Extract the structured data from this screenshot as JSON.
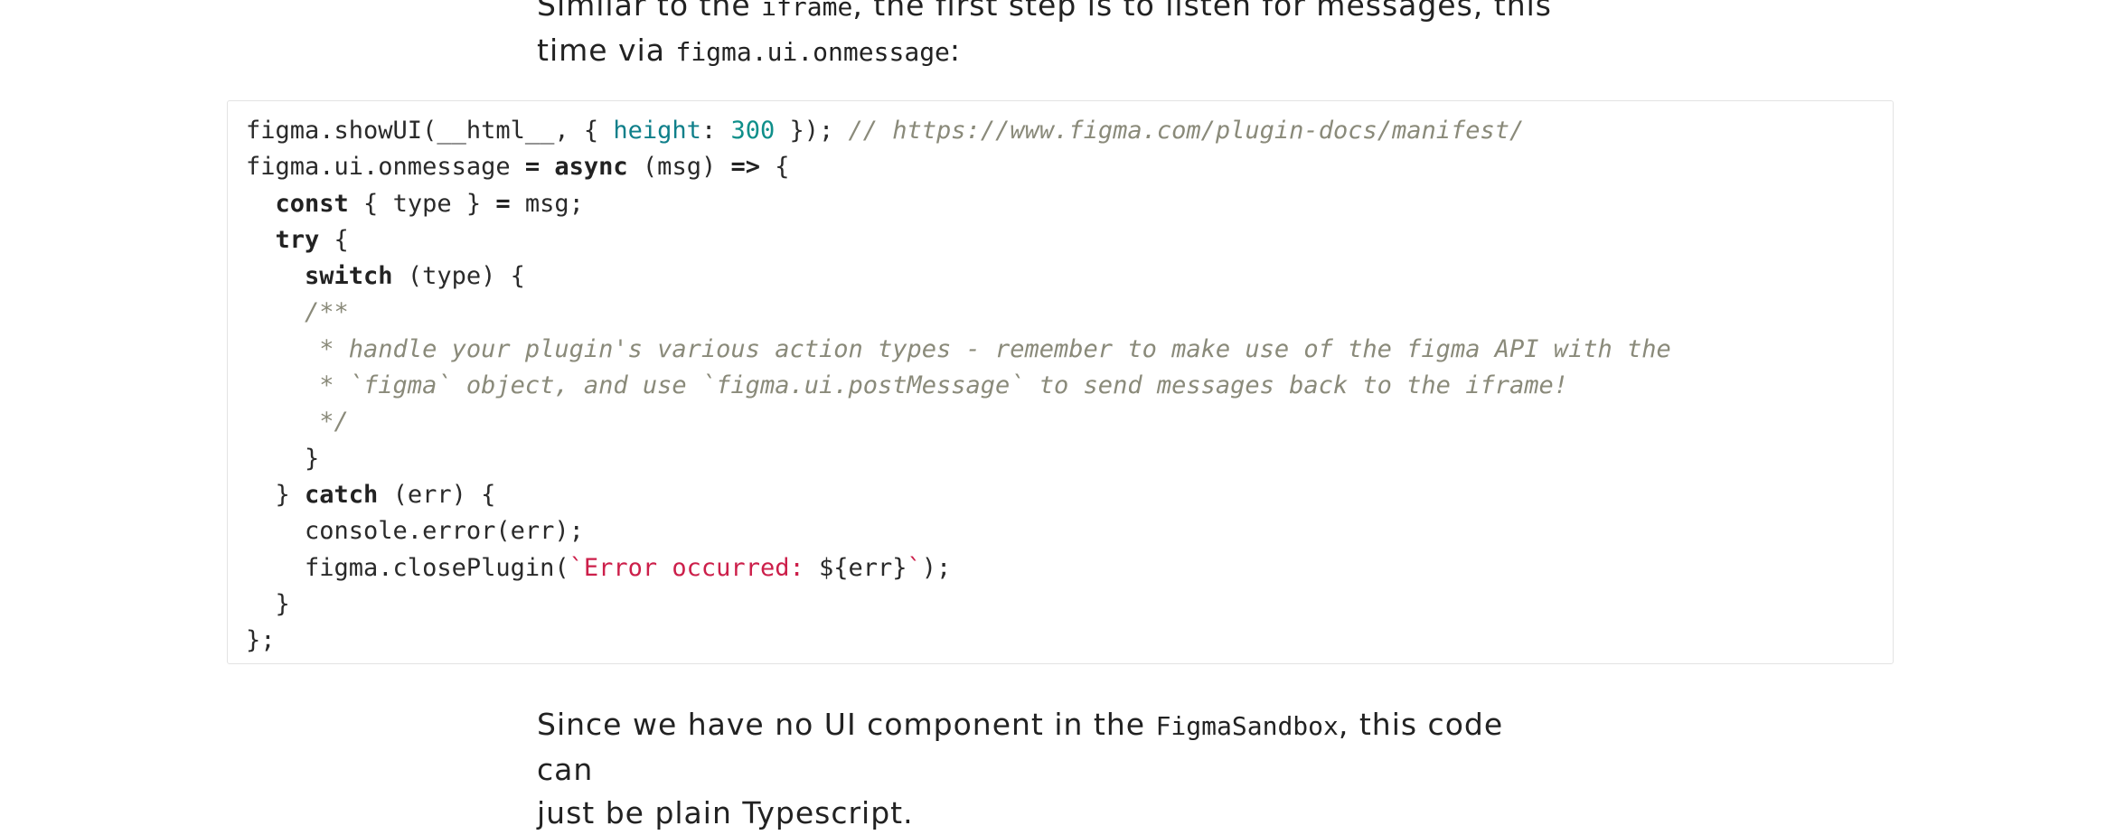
{
  "paragraph_top": {
    "line1_a": "Similar to the ",
    "line1_code": "iframe",
    "line1_b": ", the first step is to listen for messages, this",
    "line2_a": "time via ",
    "line2_code": "figma.ui.onmessage",
    "line2_b": ":"
  },
  "code": {
    "l1_a": "figma.showUI(__html__, { ",
    "l1_prop": "height",
    "l1_b": ": ",
    "l1_num": "300",
    "l1_c": " }); ",
    "l1_comment": "// https://www.figma.com/plugin-docs/manifest/",
    "l2_a": "figma.ui.onmessage ",
    "l2_eq": "=",
    "l2_b": " ",
    "l2_async": "async",
    "l2_c": " (msg) ",
    "l2_arrow": "=>",
    "l2_d": " {",
    "l3_indent": "  ",
    "l3_const": "const",
    "l3_a": " { type } ",
    "l3_eq": "=",
    "l3_b": " msg;",
    "l4_indent": "  ",
    "l4_try": "try",
    "l4_a": " {",
    "l5_indent": "    ",
    "l5_switch": "switch",
    "l5_a": " (type) {",
    "l6": "    /**",
    "l7": "     * handle your plugin's various action types - remember to make use of the figma API with the",
    "l8": "     * `figma` object, and use `figma.ui.postMessage` to send messages back to the iframe!",
    "l9": "     */",
    "l10": "    }",
    "l11_a": "  } ",
    "l11_catch": "catch",
    "l11_b": " (err) {",
    "l12": "    console.error(err);",
    "l13_a": "    figma.closePlugin(",
    "l13_str": "`Error occurred: ",
    "l13_b": "${err}",
    "l13_str2": "`",
    "l13_c": ");",
    "l14": "  }",
    "l15": "};"
  },
  "paragraph_bottom": {
    "line1_a": "Since we have no UI component in the ",
    "line1_code": "FigmaSandbox",
    "line1_b": ", this code can",
    "line2": "just be plain Typescript."
  },
  "colors": {
    "keyword": "#222222",
    "number": "#0f8f8a",
    "comment": "#8a8a7a",
    "string": "#cc1f4a"
  }
}
